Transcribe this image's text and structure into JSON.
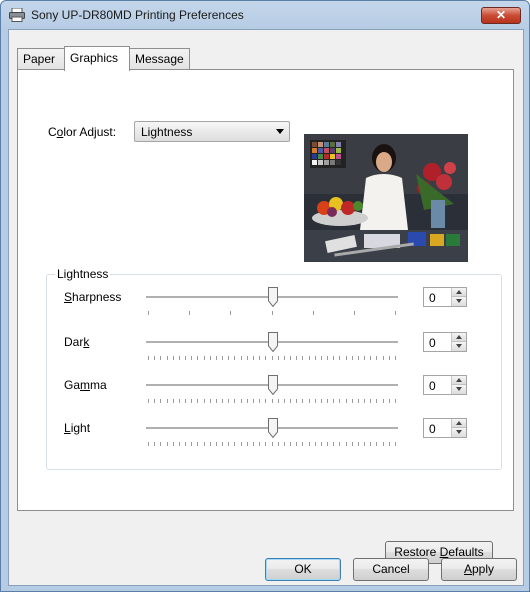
{
  "window": {
    "title": "Sony UP-DR80MD Printing Preferences",
    "close_label": "✕"
  },
  "tabs": [
    {
      "label": "Paper",
      "active": false
    },
    {
      "label": "Graphics",
      "active": true
    },
    {
      "label": "Message",
      "active": false
    }
  ],
  "color_adjust": {
    "label_pre": "C",
    "label_ul": "o",
    "label_post": "lor Adjust:",
    "value": "Lightness"
  },
  "group": {
    "title": "Lightness",
    "sliders": [
      {
        "label_pre": "",
        "label_ul": "S",
        "label_post": "harpness",
        "value": "0",
        "level": 0.5
      },
      {
        "label_pre": "Dar",
        "label_ul": "k",
        "label_post": "",
        "value": "0",
        "level": 0.5
      },
      {
        "label_pre": "Ga",
        "label_ul": "m",
        "label_post": "ma",
        "value": "0",
        "level": 0.5
      },
      {
        "label_pre": "",
        "label_ul": "L",
        "label_post": "ight",
        "value": "0",
        "level": 0.5
      }
    ]
  },
  "buttons": {
    "restore_pre": "Restore ",
    "restore_ul": "D",
    "restore_post": "efaults",
    "ok": "OK",
    "cancel": "Cancel",
    "apply_ul": "A",
    "apply_post": "pply"
  },
  "icons": {
    "printer": "printer-icon",
    "close": "close-icon",
    "dropdown": "chevron-down-icon"
  }
}
